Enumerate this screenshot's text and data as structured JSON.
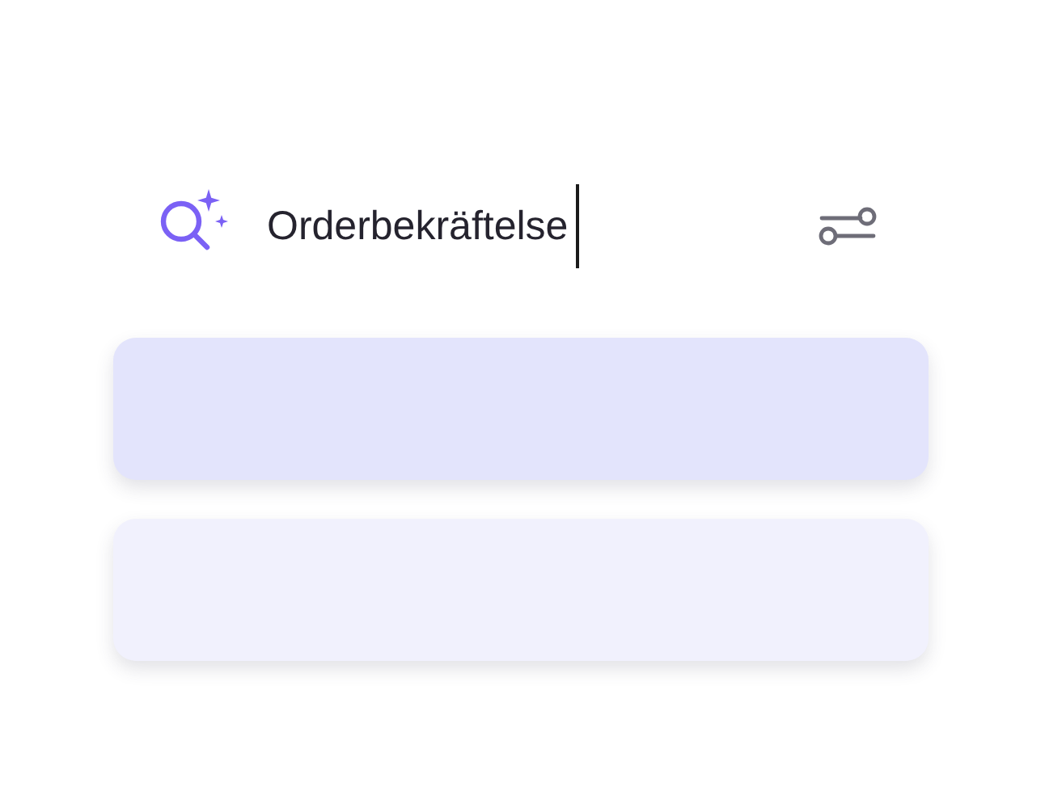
{
  "search": {
    "value": "Orderbekräftelse",
    "focused": true
  },
  "results": [
    {
      "color": "#e3e4fc"
    },
    {
      "color": "#f1f1fd"
    }
  ]
}
